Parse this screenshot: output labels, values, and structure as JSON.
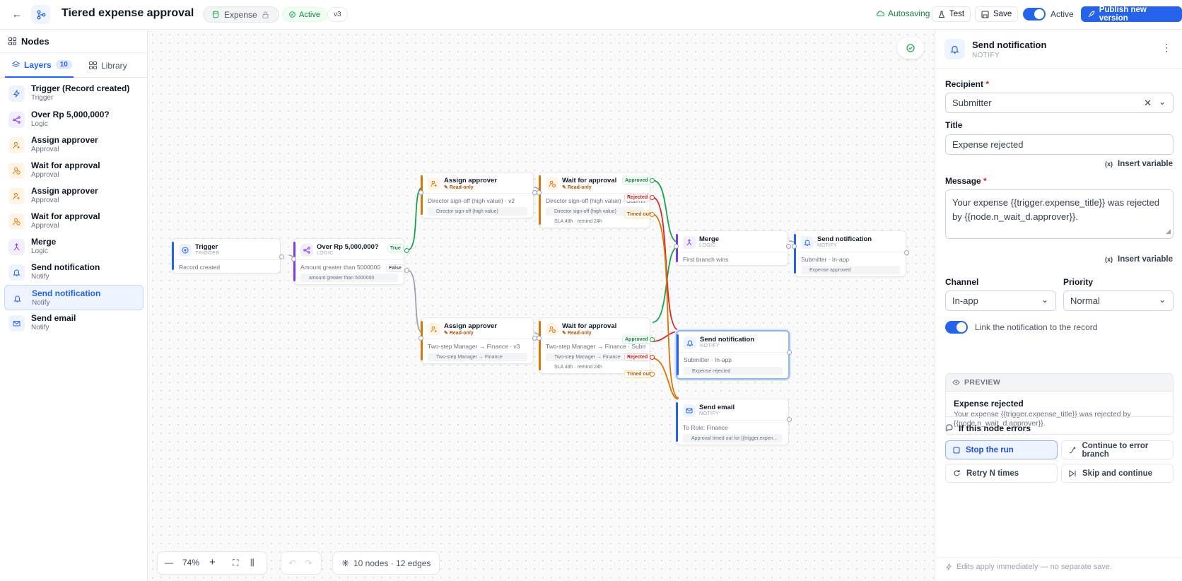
{
  "header": {
    "title": "Tiered expense approval",
    "collection": "Expense",
    "status": "Active",
    "version": "v3",
    "autosave": "Autosaving",
    "test_label": "Test",
    "save_label": "Save",
    "active_label": "Active",
    "publish_label": "Publish new version"
  },
  "left": {
    "title": "Nodes",
    "tabs": {
      "layers": "Layers",
      "layers_count": "10",
      "library": "Library"
    },
    "items": [
      {
        "name": "Trigger (Record created)",
        "type": "Trigger",
        "icon": "bolt-icon"
      },
      {
        "name": "Over Rp 5,000,000?",
        "type": "Logic",
        "icon": "branch-icon"
      },
      {
        "name": "Assign approver",
        "type": "Approval",
        "icon": "user-plus-icon"
      },
      {
        "name": "Wait for approval",
        "type": "Approval",
        "icon": "user-clock-icon"
      },
      {
        "name": "Assign approver",
        "type": "Approval",
        "icon": "user-plus-icon"
      },
      {
        "name": "Wait for approval",
        "type": "Approval",
        "icon": "user-clock-icon"
      },
      {
        "name": "Merge",
        "type": "Logic",
        "icon": "merge-icon"
      },
      {
        "name": "Send notification",
        "type": "Notify",
        "icon": "bell-icon"
      },
      {
        "name": "Send notification",
        "type": "Notify",
        "icon": "bell-icon"
      },
      {
        "name": "Send email",
        "type": "Notify",
        "icon": "mail-icon"
      }
    ]
  },
  "canvas": {
    "nodes": {
      "trigger": {
        "title": "Trigger",
        "sub": "TRIGGER",
        "body": "Record created"
      },
      "over": {
        "title": "Over Rp 5,000,000?",
        "sub": "LOGIC",
        "body": "Amount greater than 5000000",
        "chip": "amount greater than 5000000"
      },
      "assign1": {
        "title": "Assign approver",
        "sub": "Read-only",
        "body": "Director sign-off (high value) · v2",
        "chip": "Director sign-off (high value)"
      },
      "wait1": {
        "title": "Wait for approval",
        "sub": "Read-only",
        "body": "Director sign-off (high value) · Submitt",
        "chip": "Director sign-off (high value)",
        "chip2": "SLA 48h · remind 24h"
      },
      "assign2": {
        "title": "Assign approver",
        "sub": "Read-only",
        "body": "Two-step Manager → Finance · v3",
        "chip": "Two-step Manager → Finance"
      },
      "wait2": {
        "title": "Wait for approval",
        "sub": "Read-only",
        "body": "Two-step Manager → Finance · Submitt",
        "chip": "Two-step Manager → Finance",
        "chip2": "SLA 48h · remind 24h"
      },
      "merge": {
        "title": "Merge",
        "sub": "LOGIC",
        "body": "First branch wins"
      },
      "notify1": {
        "title": "Send notification",
        "sub": "NOTIFY",
        "body": "Submitter · In-app",
        "chip": "Expense approved"
      },
      "notify2": {
        "title": "Send notification",
        "sub": "NOTIFY",
        "body": "Submitter · In-app",
        "chip": "Expense rejected"
      },
      "email": {
        "title": "Send email",
        "sub": "NOTIFY",
        "body": "To Role: Finance",
        "chip": "Approval timed out for {{trigger.expen..."
      }
    },
    "branch_labels": {
      "true": "True",
      "false": "False",
      "approved": "Approved",
      "rejected": "Rejected",
      "timed_out": "Timed out"
    },
    "zoom": "74%",
    "stats": "10 nodes · 12 edges",
    "colors": {
      "true": "#16a34a",
      "rejected": "#dc2626",
      "timeout": "#d97706",
      "neutral": "#9ca3af",
      "accent": "#2563eb"
    }
  },
  "inspector": {
    "title": "Send notification",
    "subtitle": "NOTIFY",
    "recipient_label": "Recipient",
    "recipient_value": "Submitter",
    "title_label": "Title",
    "title_value": "Expense rejected",
    "insert_variable": "Insert variable",
    "message_label": "Message",
    "message_value": "Your expense {{trigger.expense_title}} was rejected by {{node.n_wait_d.approver}}.",
    "channel_label": "Channel",
    "channel_value": "In-app",
    "priority_label": "Priority",
    "priority_value": "Normal",
    "link_toggle_label": "Link the notification to the record",
    "preview_label": "PREVIEW",
    "preview_title": "Expense rejected",
    "preview_body": "Your expense {{trigger.expense_title}} was rejected by {{node.n_wait_d.approver}}.",
    "errors_label": "If this node errors",
    "error_options": [
      "Stop the run",
      "Continue to error branch",
      "Retry N times",
      "Skip and continue"
    ],
    "footer": "Edits apply immediately — no separate save."
  }
}
